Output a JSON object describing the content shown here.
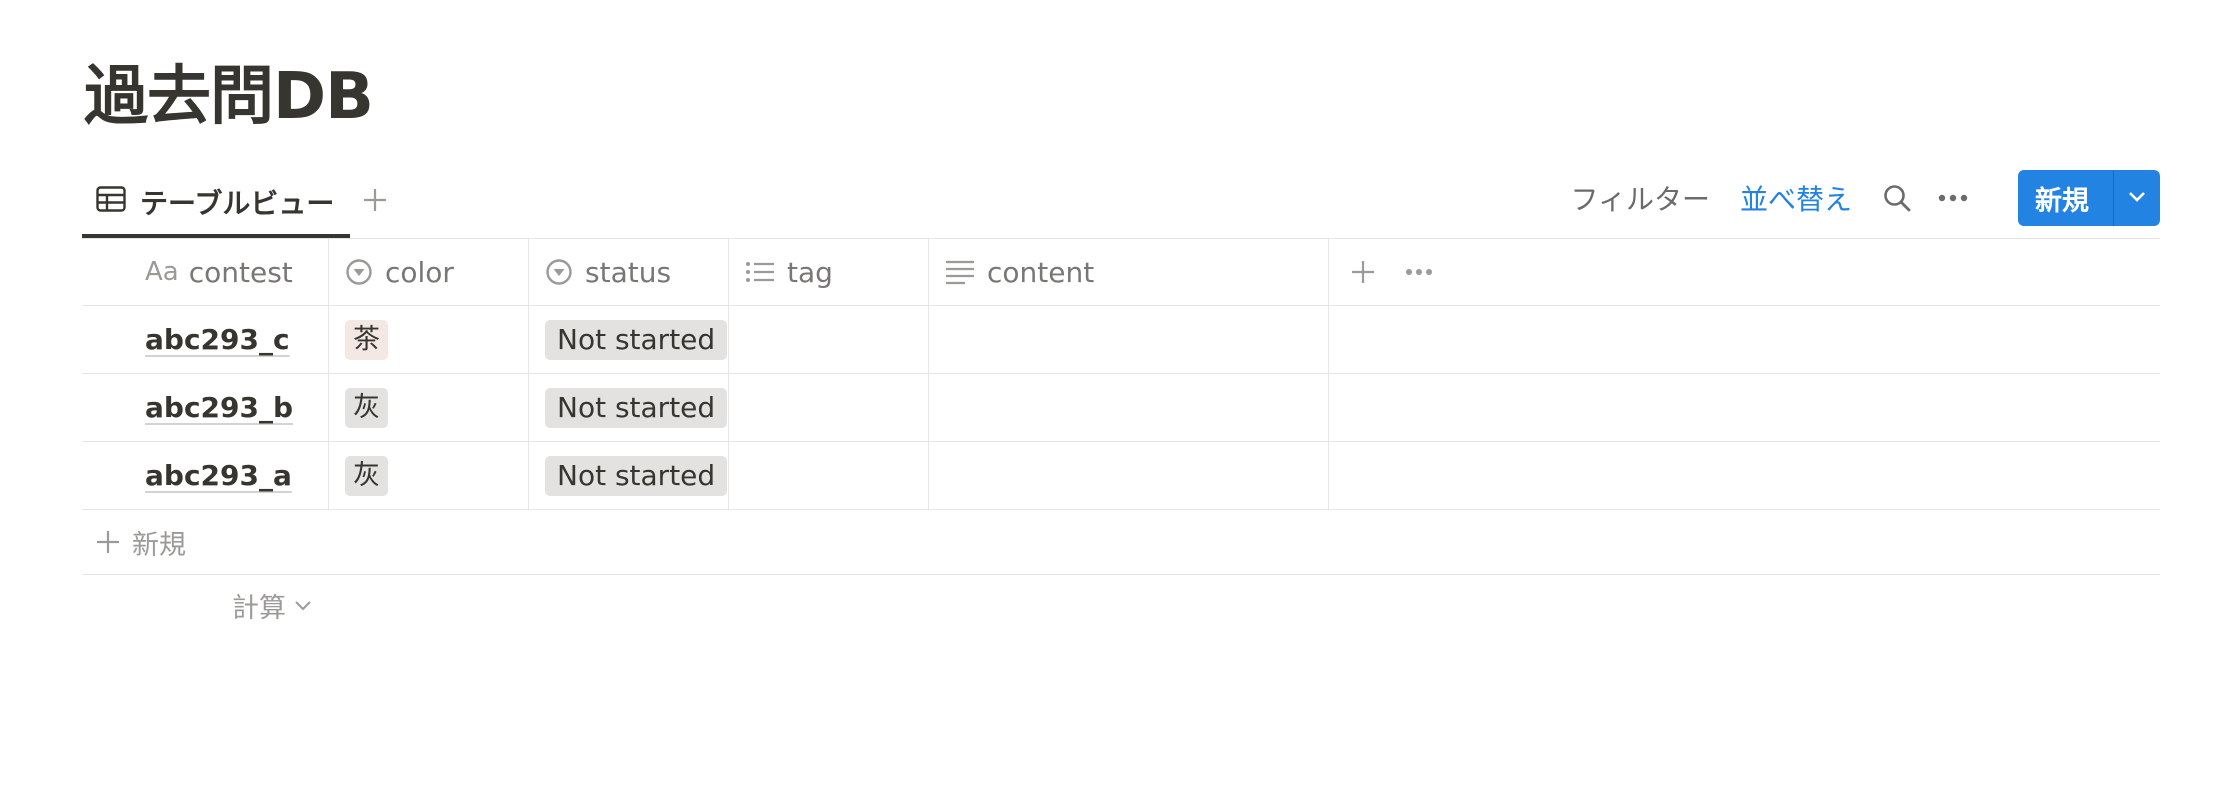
{
  "page": {
    "title": "過去問DB"
  },
  "view": {
    "tab_label": "テーブルビュー",
    "add_icon": "plus-icon"
  },
  "toolbar": {
    "filter_label": "フィルター",
    "sort_label": "並べ替え",
    "new_label": "新規",
    "accent_color": "#2383e2"
  },
  "table": {
    "columns": [
      {
        "icon": "Aa",
        "label": "contest"
      },
      {
        "icon": "select-icon",
        "label": "color"
      },
      {
        "icon": "status-icon",
        "label": "status"
      },
      {
        "icon": "list-icon",
        "label": "tag"
      },
      {
        "icon": "text-icon",
        "label": "content"
      }
    ],
    "rows": [
      {
        "contest": "abc293_c",
        "color": "茶",
        "color_tone": "brown",
        "status": "Not started",
        "tag": "",
        "content": ""
      },
      {
        "contest": "abc293_b",
        "color": "灰",
        "color_tone": "gray",
        "status": "Not started",
        "tag": "",
        "content": ""
      },
      {
        "contest": "abc293_a",
        "color": "灰",
        "color_tone": "gray",
        "status": "Not started",
        "tag": "",
        "content": ""
      }
    ],
    "new_row_label": "新規",
    "calc_label": "計算"
  }
}
